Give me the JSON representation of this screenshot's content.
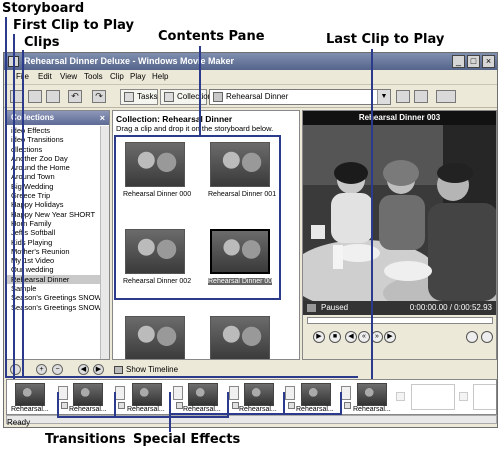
{
  "callouts": {
    "storyboard": "Storyboard",
    "first_clip": "First Clip to Play",
    "clips": "Clips",
    "contents_pane": "Contents Pane",
    "last_clip": "Last Clip to Play",
    "transitions": "Transitions",
    "special_effects": "Special Effects"
  },
  "window": {
    "title": "Rehearsal Dinner Deluxe - Windows Movie Maker",
    "buttons": [
      "_",
      "□",
      "×"
    ]
  },
  "menu": [
    "File",
    "Edit",
    "View",
    "Tools",
    "Clip",
    "Play",
    "Help"
  ],
  "toolbar": {
    "tasks_label": "Tasks",
    "collections_label": "Collections",
    "collection_select": "Rehearsal Dinner"
  },
  "collections_pane": {
    "header": "Collections",
    "close": "×",
    "items": [
      "ideo Effects",
      "ideo Transitions",
      "ollections",
      "Another Zoo Day",
      "Around the Home",
      "Around Town",
      "Big Wedding",
      "Greece Trip",
      "Happy Holidays",
      "Happy New Year SHORT",
      "Horn Family",
      "Jeff's Softball",
      "Kids Playing",
      "Mother's Reunion",
      "My 1st Video",
      "Our wedding",
      "Rehearsal Dinner",
      "Sample",
      "Season's Greetings SNOW/BA",
      "Season's Greetings SNOW/BA"
    ],
    "selected_index": 16
  },
  "contents_pane": {
    "title": "Collection: Rehearsal Dinner",
    "hint": "Drag a clip and drop it on the storyboard below.",
    "clips": [
      "Rehearsal Dinner 000",
      "Rehearsal Dinner 001",
      "Rehearsal Dinner 002",
      "Rehearsal Dinner 003"
    ],
    "selected_index": 3
  },
  "monitor": {
    "title": "Rehearsal Dinner 003",
    "status": "Paused",
    "time": "0:00:00.00 / 0:00:52.93"
  },
  "storyboard": {
    "show_timeline": "Show Timeline",
    "clip_label": "Rehearsal..."
  },
  "statusbar": {
    "text": "Ready"
  }
}
